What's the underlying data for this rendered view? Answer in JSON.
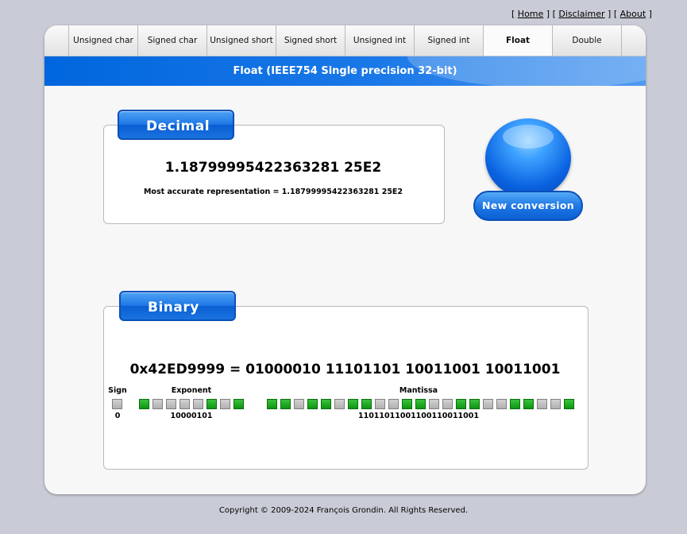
{
  "top_links": {
    "open": "[ ",
    "home": "Home",
    "sep1": " ] [ ",
    "disclaimer": "Disclaimer",
    "sep2": " ] [ ",
    "about": "About",
    "close": " ]"
  },
  "tabs": [
    "Unsigned char",
    "Signed char",
    "Unsigned short",
    "Signed short",
    "Unsigned int",
    "Signed int",
    "Float",
    "Double"
  ],
  "active_tab": "Float",
  "banner_title": "Float (IEEE754 Single precision 32-bit)",
  "decimal": {
    "label": "Decimal",
    "value": "1.18799995422363281 25E2",
    "accurate": "Most accurate representation = 1.18799995422363281 25E2"
  },
  "new_conversion": "New conversion",
  "binary": {
    "label": "Binary",
    "hex_expression": "0x42ED9999 = 01000010 11101101 10011001 10011001",
    "sign_label": "Sign",
    "exponent_label": "Exponent",
    "mantissa_label": "Mantissa",
    "sign_bits": "0",
    "exponent_bits": "10000101",
    "mantissa_bits": "11011011001100110011001"
  },
  "footer": "Copyright © 2009-2024 François Grondin. All Rights Reserved.",
  "colors": {
    "accent_blue": "#1f78e6",
    "bit_on": "#1fa822",
    "bit_off": "#bdbdbd",
    "page_bg": "#c9ccd6"
  }
}
